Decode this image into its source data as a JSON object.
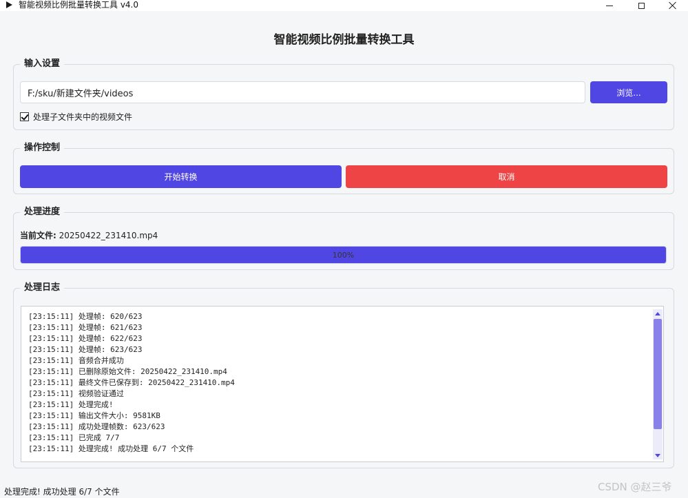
{
  "window": {
    "title": "智能视频比例批量转换工具 v4.0",
    "icon": "play-icon"
  },
  "app": {
    "heading": "智能视频比例批量转换工具"
  },
  "input_section": {
    "title": "输入设置",
    "path_value": "F:/sku/新建文件夹/videos",
    "browse_label": "浏览...",
    "include_subfolders_label": "处理子文件夹中的视频文件",
    "include_subfolders_checked": true
  },
  "control_section": {
    "title": "操作控制",
    "start_label": "开始转换",
    "cancel_label": "取消",
    "colors": {
      "start": "#5046e4",
      "cancel": "#ef4445"
    }
  },
  "progress_section": {
    "title": "处理进度",
    "current_file_label": "当前文件:",
    "current_file_name": "20250422_231410.mp4",
    "percent_text": "100%",
    "percent": 100
  },
  "log_section": {
    "title": "处理日志",
    "lines": [
      "[23:15:11] 处理帧: 620/623",
      "[23:15:11] 处理帧: 621/623",
      "[23:15:11] 处理帧: 622/623",
      "[23:15:11] 处理帧: 623/623",
      "[23:15:11] 音频合并成功",
      "[23:15:11] 已删除原始文件: 20250422_231410.mp4",
      "[23:15:11] 最终文件已保存到: 20250422_231410.mp4",
      "[23:15:11] 视频验证通过",
      "[23:15:11] 处理完成!",
      "[23:15:11] 输出文件大小: 9581KB",
      "[23:15:11] 成功处理帧数: 623/623",
      "[23:15:11] 已完成 7/7",
      "[23:15:11] 处理完成! 成功处理 6/7 个文件"
    ]
  },
  "status_bar": {
    "text": "处理完成! 成功处理 6/7 个文件"
  },
  "watermark": {
    "text": "CSDN @赵三爷"
  }
}
